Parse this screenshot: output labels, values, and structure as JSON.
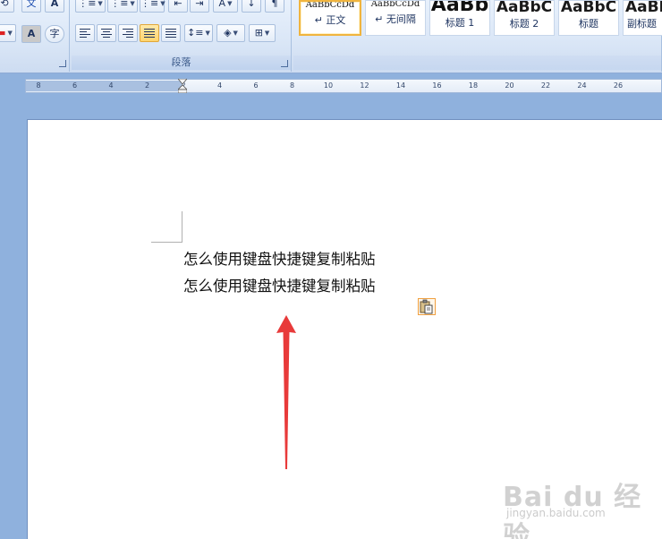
{
  "ribbon": {
    "groups": {
      "paragraph_label": "段落"
    },
    "font_group": {
      "wen_label": "文",
      "char_border_label": "A",
      "char_shade_label": "A",
      "enclose_label": "字"
    },
    "styles": [
      {
        "sample": "AaBbCcDd",
        "name": "↵ 正文",
        "selected": true
      },
      {
        "sample": "AaBbCcDd",
        "name": "↵ 无间隔",
        "selected": false
      },
      {
        "sample": "AaBb",
        "name": "标题 1",
        "selected": false
      },
      {
        "sample": "AaBbC",
        "name": "标题 2",
        "selected": false
      },
      {
        "sample": "AaBbC",
        "name": "标题",
        "selected": false
      },
      {
        "sample": "AaBbC",
        "name": "副标题",
        "selected": false
      }
    ]
  },
  "ruler": {
    "numbers": [
      "8",
      "6",
      "4",
      "2",
      "2",
      "4",
      "6",
      "8",
      "10",
      "12",
      "14",
      "16",
      "18",
      "20",
      "22",
      "24",
      "26"
    ]
  },
  "document": {
    "lines": [
      "怎么使用键盘快捷键复制粘贴",
      "怎么使用键盘快捷键复制粘贴"
    ]
  },
  "annotation": {
    "arrow_color": "#e83a3a"
  },
  "watermark": {
    "brand": "Bai du 经验",
    "url": "jingyan.baidu.com"
  }
}
